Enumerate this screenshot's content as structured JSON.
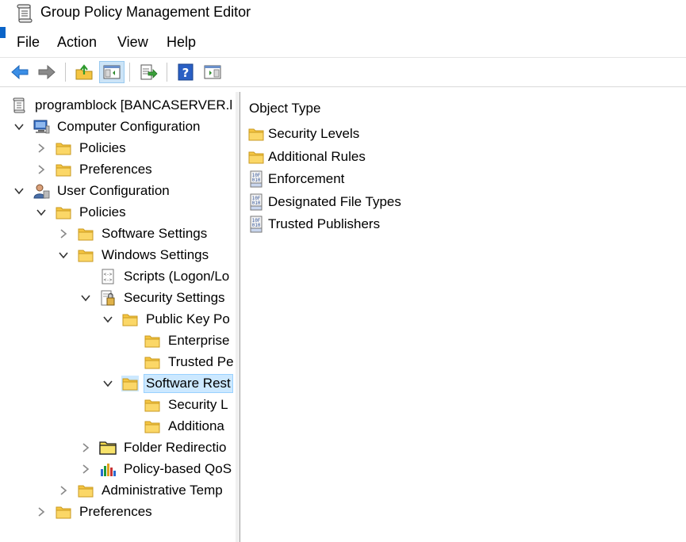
{
  "window": {
    "title": "Group Policy Management Editor"
  },
  "menu": [
    "File",
    "Action",
    "View",
    "Help"
  ],
  "toolbar": {
    "buttons": [
      "back-icon",
      "forward-icon",
      "up-folder-icon",
      "show-hide-tree-icon",
      "export-list-icon",
      "help-icon",
      "show-hide-action-pane-icon"
    ]
  },
  "tree": [
    {
      "label": "programblock [BANCASERVER.l",
      "icon": "gpo-icon",
      "expander": "none",
      "level": 0
    },
    {
      "label": "Computer Configuration",
      "icon": "computer-icon",
      "expander": "expanded",
      "level": 0
    },
    {
      "label": "Policies",
      "icon": "folder-icon",
      "expander": "collapsed",
      "level": 1
    },
    {
      "label": "Preferences",
      "icon": "folder-icon",
      "expander": "collapsed",
      "level": 1
    },
    {
      "label": "User Configuration",
      "icon": "user-icon",
      "expander": "expanded",
      "level": 0
    },
    {
      "label": "Policies",
      "icon": "folder-icon",
      "expander": "expanded",
      "level": 1
    },
    {
      "label": "Software Settings",
      "icon": "folder-icon",
      "expander": "collapsed",
      "level": 2
    },
    {
      "label": "Windows Settings",
      "icon": "folder-icon",
      "expander": "expanded",
      "level": 2
    },
    {
      "label": "Scripts (Logon/Lo",
      "icon": "script-icon",
      "expander": "none",
      "level": 3
    },
    {
      "label": "Security Settings",
      "icon": "security-settings-icon",
      "expander": "expanded",
      "level": 3
    },
    {
      "label": "Public Key Po",
      "icon": "folder-icon",
      "expander": "expanded",
      "level": 4
    },
    {
      "label": "Enterprise",
      "icon": "folder-icon",
      "expander": "none",
      "level": 5
    },
    {
      "label": "Trusted Pe",
      "icon": "folder-icon",
      "expander": "none",
      "level": 5
    },
    {
      "label": "Software Rest",
      "icon": "folder-icon",
      "expander": "expanded",
      "level": 4,
      "selected": true
    },
    {
      "label": "Security L",
      "icon": "folder-icon",
      "expander": "none",
      "level": 5
    },
    {
      "label": "Additiona",
      "icon": "folder-icon",
      "expander": "none",
      "level": 5
    },
    {
      "label": "Folder Redirectio",
      "icon": "folder-redirection-icon",
      "expander": "collapsed",
      "level": 3
    },
    {
      "label": "Policy-based QoS",
      "icon": "qos-chart-icon",
      "expander": "collapsed",
      "level": 3
    },
    {
      "label": "Administrative Temp",
      "icon": "folder-icon",
      "expander": "collapsed",
      "level": 2
    },
    {
      "label": "Preferences",
      "icon": "folder-icon",
      "expander": "collapsed",
      "level": 1
    }
  ],
  "content": {
    "column_header": "Object Type",
    "items": [
      {
        "label": "Security Levels",
        "icon": "folder-icon"
      },
      {
        "label": "Additional Rules",
        "icon": "folder-icon"
      },
      {
        "label": "Enforcement",
        "icon": "binary-policy-icon"
      },
      {
        "label": "Designated File Types",
        "icon": "binary-policy-icon"
      },
      {
        "label": "Trusted Publishers",
        "icon": "binary-policy-icon"
      }
    ]
  },
  "colors": {
    "selection": "#cce8ff",
    "folder": "#f5c542",
    "accent": "#0a64c8"
  }
}
